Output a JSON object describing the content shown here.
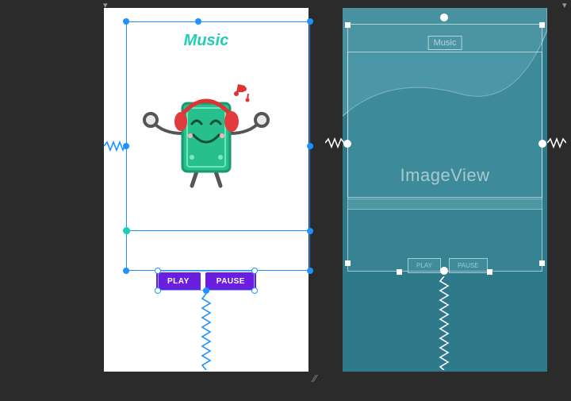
{
  "preview": {
    "title": "Music",
    "buttons": {
      "play": "PLAY",
      "pause": "PAUSE"
    }
  },
  "blueprint": {
    "title": "Music",
    "imageview_placeholder": "ImageView",
    "buttons": {
      "play": "PLAY",
      "pause": "PAUSE"
    }
  },
  "colors": {
    "accent_teal": "#1fcfb4",
    "button_purple": "#6a1fe0",
    "selection_blue": "#1e90ff",
    "blueprint_bg": "#2f7a8a"
  }
}
